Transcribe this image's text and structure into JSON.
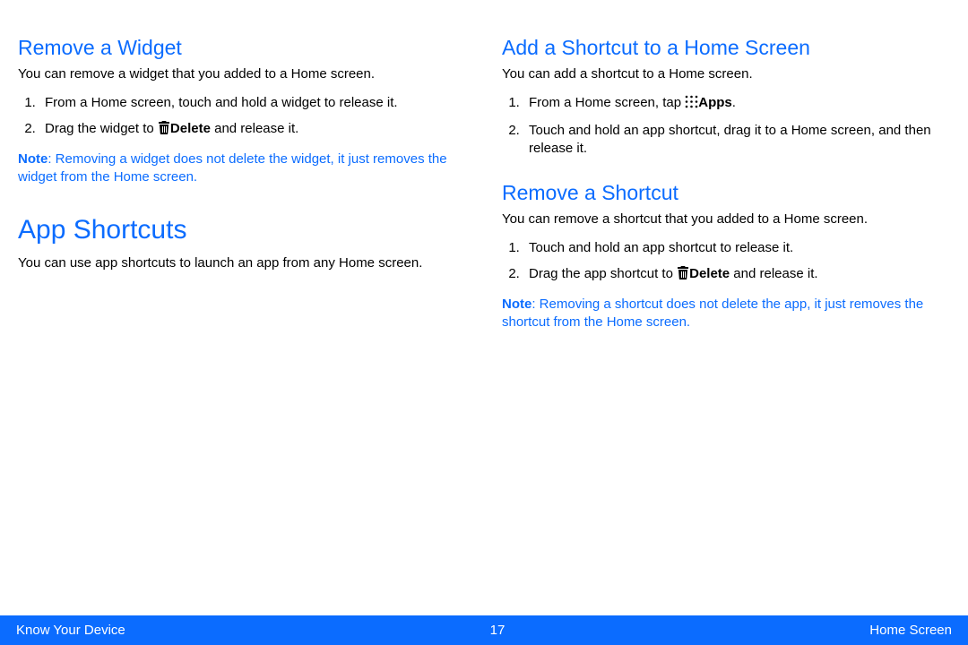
{
  "left": {
    "removeWidget": {
      "heading": "Remove a Widget",
      "intro": "You can remove a widget that you added to a Home screen.",
      "steps": {
        "s1": "From a Home screen, touch and hold a widget to release it.",
        "s2a": "Drag the widget to ",
        "s2_bold": "Delete",
        "s2b": "  and release it."
      },
      "note_label": "Note",
      "note_body": ": Removing a widget does not delete the widget, it just removes the widget from the Home screen."
    },
    "appShortcuts": {
      "heading": "App Shortcuts",
      "intro": "You can use app shortcuts to launch an app from any Home screen."
    }
  },
  "right": {
    "addShortcut": {
      "heading": "Add a Shortcut to a Home Screen",
      "intro": "You can add a shortcut to a Home screen.",
      "steps": {
        "s1a": "From a Home screen, tap ",
        "s1_bold": "Apps",
        "s1b": ".",
        "s2": "Touch and hold an app shortcut, drag it to a Home screen, and then release it."
      }
    },
    "removeShortcut": {
      "heading": "Remove a Shortcut",
      "intro": "You can remove a shortcut that you added to a Home screen.",
      "steps": {
        "s1": "Touch and hold an app shortcut to release it.",
        "s2a": "Drag the app shortcut to ",
        "s2_bold": "Delete",
        "s2b": "  and release it."
      },
      "note_label": "Note",
      "note_body": ": Removing a shortcut does not delete the app, it just removes the shortcut from the Home screen."
    }
  },
  "footer": {
    "left": "Know Your Device",
    "center": "17",
    "right": "Home Screen"
  }
}
